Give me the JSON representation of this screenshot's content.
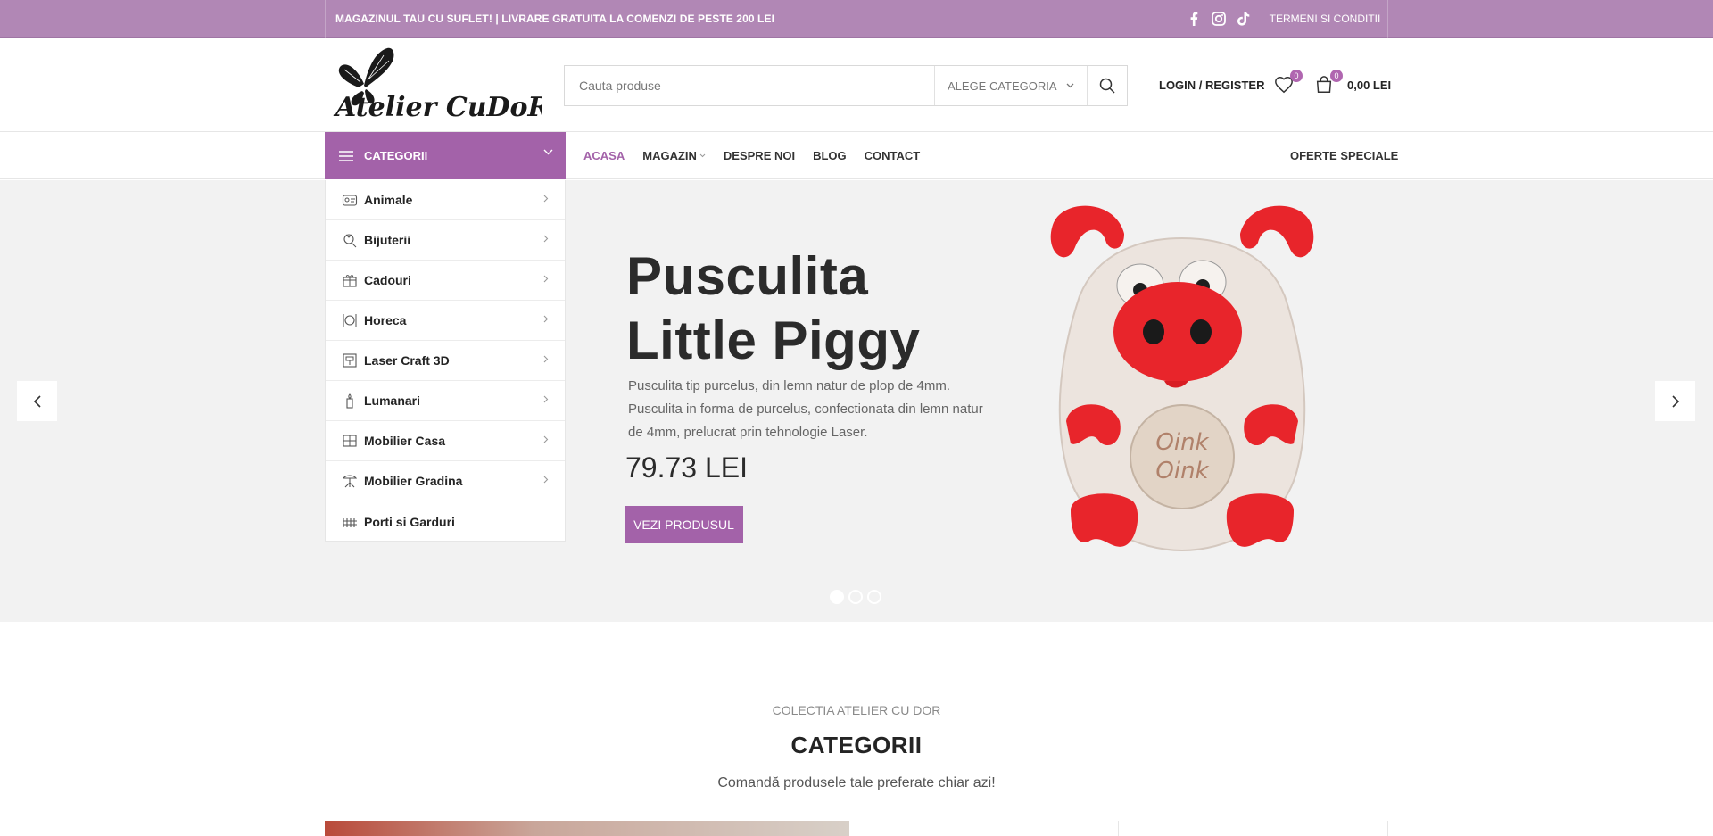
{
  "topbar": {
    "promo": "MAGAZINUL TAU CU SUFLET! | LIVRARE GRATUITA LA COMENZI DE PESTE 200 LEI",
    "socials": [
      "facebook-icon",
      "instagram-icon",
      "tiktok-icon"
    ],
    "terms": "TERMENI SI CONDITII"
  },
  "header": {
    "logo_text": "Atelier CuDoR",
    "search_placeholder": "Cauta produse",
    "category_select": "ALEGE CATEGORIA",
    "login": "LOGIN / REGISTER",
    "wishlist_count": "0",
    "cart_count": "0",
    "cart_total": "0,00 LEI"
  },
  "nav": {
    "categories_label": "CATEGORII",
    "items": [
      {
        "label": "ACASA",
        "active": true
      },
      {
        "label": "MAGAZIN",
        "dropdown": true
      },
      {
        "label": "DESPRE NOI"
      },
      {
        "label": "BLOG"
      },
      {
        "label": "CONTACT"
      }
    ],
    "special": "OFERTE SPECIALE"
  },
  "categories": [
    {
      "label": "Animale"
    },
    {
      "label": "Bijuterii"
    },
    {
      "label": "Cadouri"
    },
    {
      "label": "Horeca"
    },
    {
      "label": "Laser Craft 3D"
    },
    {
      "label": "Lumanari"
    },
    {
      "label": "Mobilier Casa"
    },
    {
      "label": "Mobilier Gradina"
    },
    {
      "label": "Porti si Garduri"
    }
  ],
  "slide": {
    "title_line1": "Pusculita",
    "title_line2": "Little Piggy",
    "description": "Pusculita tip purcelus, din lemn natur de plop de 4mm. Pusculita in forma de purcelus, confectionata din lemn natur de 4mm, prelucrat prin tehnologie Laser.",
    "price": "79.73 LEI",
    "button": "VEZI PRODUSUL",
    "image_text1": "Oink",
    "image_text2": "Oink",
    "dots": 3,
    "active_dot": 1
  },
  "section": {
    "subtitle": "COLECTIA ATELIER CU DOR",
    "title": "CATEGORII",
    "tagline": "Comandă produsele tale preferate chiar azi!"
  },
  "colors": {
    "topbar": "#b187b5",
    "accent": "#a362a9",
    "hero_bg": "#f2f2f2"
  }
}
